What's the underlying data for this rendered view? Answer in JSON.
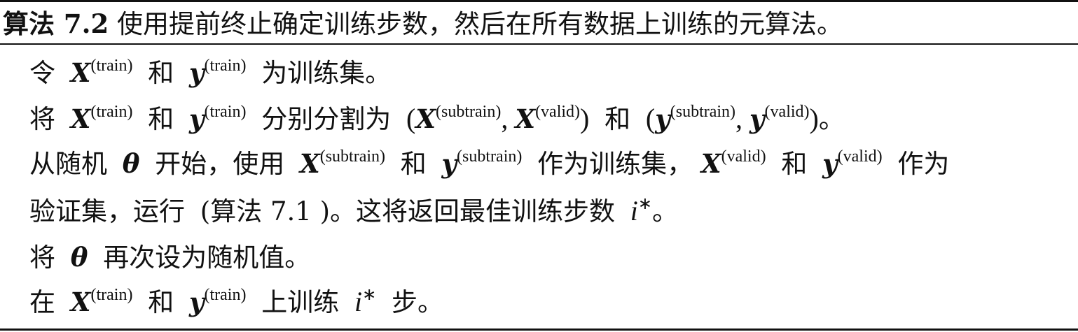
{
  "caption": {
    "label": "算法 7.2",
    "text": "使用提前终止确定训练步数，然后在所有数据上训练的元算法。"
  },
  "sym": {
    "X": "X",
    "y": "y",
    "theta": "θ",
    "i": "i",
    "star": "∗",
    "train": "(train)",
    "subtrain": "(subtrain)",
    "valid": "(valid)",
    "open": "(",
    "close": ")",
    "comma": ",",
    "comma_cn": "，",
    "period": "。"
  },
  "lines": {
    "l1": {
      "a": "令",
      "b": "和",
      "c": "为训练集。"
    },
    "l2": {
      "a": "将",
      "b": "和",
      "c": "分别分割为",
      "d": "和"
    },
    "l3": {
      "a": "从随机",
      "b": "开始，使用",
      "c": "和",
      "d": "作为训练集，",
      "e": "和",
      "f": "作为"
    },
    "l4": {
      "a": "验证集，运行",
      "b": "(算法 7.1 )。这将返回最佳训练步数"
    },
    "l5": {
      "a": "将",
      "b": "再次设为随机值。"
    },
    "l6": {
      "a": "在",
      "b": "和",
      "c": "上训练",
      "d": "步。"
    }
  }
}
